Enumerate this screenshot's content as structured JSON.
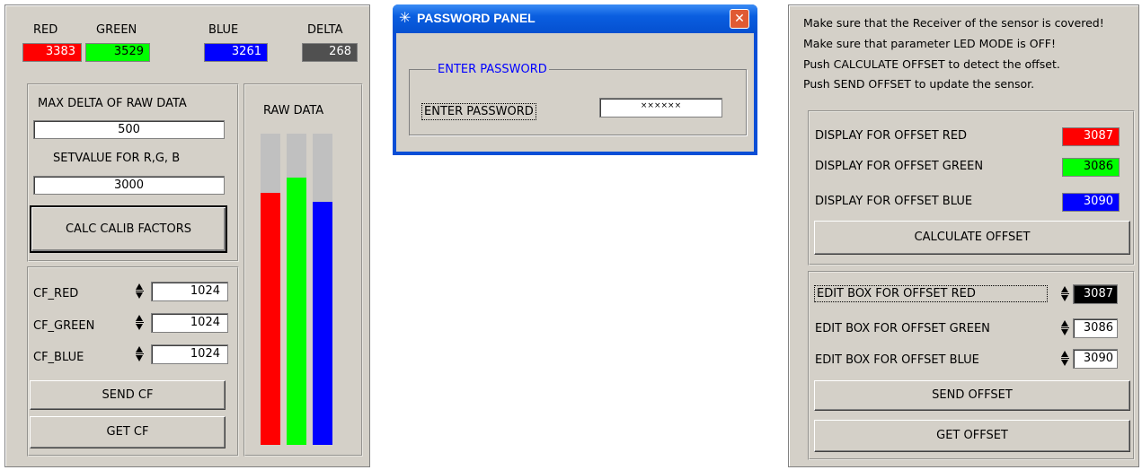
{
  "left_panel": {
    "headers": {
      "red": "RED",
      "green": "GREEN",
      "blue": "BLUE",
      "delta": "DELTA"
    },
    "values": {
      "red": "3383",
      "green": "3529",
      "blue": "3261",
      "delta": "268"
    },
    "colors": {
      "red": "#ff0000",
      "green": "#00ff00",
      "blue": "#0000ff",
      "delta": "#505050"
    },
    "max_delta_label": "MAX DELTA OF RAW DATA",
    "max_delta_value": "500",
    "setvalue_label": "SETVALUE FOR R,G, B",
    "setvalue_value": "3000",
    "calc_button": "CALC CALIB FACTORS",
    "raw_data_label": "RAW DATA",
    "raw_levels": {
      "red": 0.81,
      "green": 0.86,
      "blue": 0.78
    },
    "cf": [
      {
        "label": "CF_RED",
        "value": "1024"
      },
      {
        "label": "CF_GREEN",
        "value": "1024"
      },
      {
        "label": "CF_BLUE",
        "value": "1024"
      }
    ],
    "send_cf": "SEND CF",
    "get_cf": "GET CF"
  },
  "password_dialog": {
    "title": "PASSWORD PANEL",
    "group_label": "ENTER PASSWORD",
    "field_label": "ENTER PASSWORD",
    "field_value": "××××××",
    "close_symbol": "✕"
  },
  "right_panel": {
    "instructions": [
      "Make sure that the Receiver of the sensor is covered!",
      "Make sure that parameter LED MODE is OFF!",
      "Push CALCULATE OFFSET to detect the offset.",
      "Push SEND OFFSET to update the sensor."
    ],
    "displays": [
      {
        "label": "DISPLAY FOR OFFSET RED",
        "value": "3087",
        "color": "#ff0000",
        "text_color": "#ffffff"
      },
      {
        "label": "DISPLAY FOR OFFSET GREEN",
        "value": "3086",
        "color": "#00ff00",
        "text_color": "#000000"
      },
      {
        "label": "DISPLAY FOR OFFSET BLUE",
        "value": "3090",
        "color": "#0000ff",
        "text_color": "#ffffff"
      }
    ],
    "calculate_offset": "CALCULATE OFFSET",
    "edits": [
      {
        "label": "EDIT BOX FOR OFFSET RED",
        "value": "3087"
      },
      {
        "label": "EDIT BOX FOR OFFSET GREEN",
        "value": "3086"
      },
      {
        "label": "EDIT BOX FOR OFFSET BLUE",
        "value": "3090"
      }
    ],
    "send_offset": "SEND OFFSET",
    "get_offset": "GET OFFSET"
  }
}
